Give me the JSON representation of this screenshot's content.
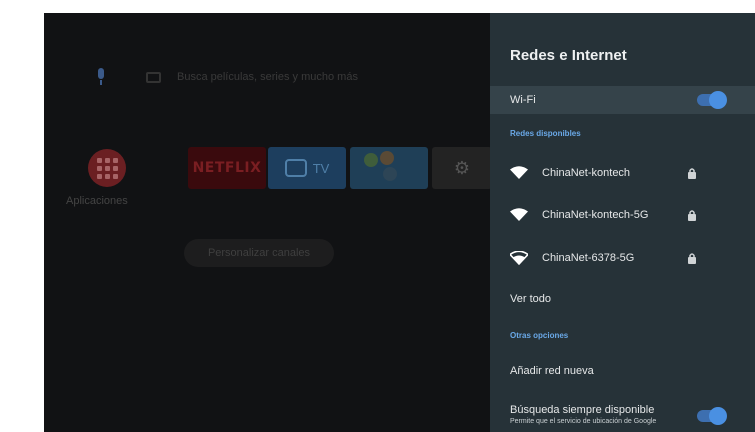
{
  "home": {
    "search_placeholder": "Busca películas, series y mucho más",
    "apps_label": "Aplicaciones",
    "apps": [
      {
        "name": "NETFLIX"
      },
      {
        "name": "TV"
      }
    ],
    "channels_button": "Personalizar canales"
  },
  "panel": {
    "title": "Redes e Internet",
    "wifi_label": "Wi-Fi",
    "wifi_enabled": true,
    "available_section": "Redes disponibles",
    "networks": [
      {
        "name": "ChinaNet-kontech",
        "secured": true,
        "icon": "wifi-full-icon"
      },
      {
        "name": "ChinaNet-kontech-5G",
        "secured": true,
        "icon": "wifi-full-icon"
      },
      {
        "name": "ChinaNet-6378-5G",
        "secured": true,
        "icon": "wifi-medium-icon"
      }
    ],
    "see_all": "Ver todo",
    "other_section": "Otras opciones",
    "add_network": "Añadir red nueva",
    "scan_always_title": "Búsqueda siempre disponible",
    "scan_always_desc": "Permite que el servicio de ubicación de Google",
    "scan_always_enabled": true
  },
  "colors": {
    "panel_bg": "#263238",
    "accent": "#4a90e2",
    "section_text": "#6aa9e8"
  }
}
